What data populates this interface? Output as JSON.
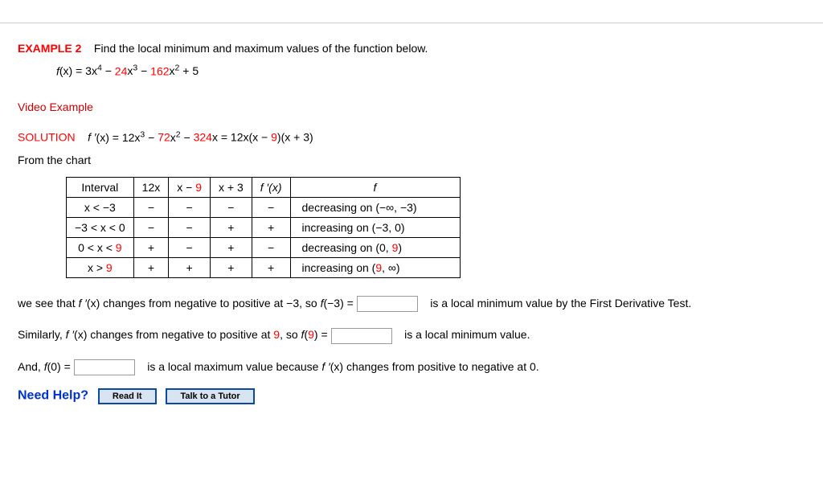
{
  "header": {
    "example_label": "EXAMPLE 2",
    "prompt_text": "Find the local minimum and maximum values of the function below.",
    "fx_lead": "f",
    "fx_open": "(x) = 3x",
    "fx_p1_sup": "4",
    "fx_p1_after": " − ",
    "fx_c2": "24",
    "fx_p2_x": "x",
    "fx_p2_sup": "3",
    "fx_p2_after": " − ",
    "fx_c3": "162",
    "fx_p3_x": "x",
    "fx_p3_sup": "2",
    "fx_tail": " + 5"
  },
  "video_link": "Video Example",
  "solution": {
    "label": "SOLUTION",
    "deriv_lead": "f ′",
    "deriv_open": "(x) = 12x",
    "deriv_sup1": "3",
    "deriv_mid1": " − ",
    "deriv_c2": "72",
    "deriv_x2": "x",
    "deriv_sup2": "2",
    "deriv_mid2": " − ",
    "deriv_c3": "324",
    "deriv_x3": "x",
    "deriv_factored_a": " = 12x(x − ",
    "deriv_root1": "9",
    "deriv_factored_b": ")(x + 3)",
    "from_chart": "From the chart"
  },
  "table": {
    "h1": "Interval",
    "h2": "12x",
    "h3a": "x − ",
    "h3b": "9",
    "h4": "x + 3",
    "h5": "f ′(x)",
    "h6": "f",
    "r1_int": "x < −3",
    "r1_a": "−",
    "r1_b": "−",
    "r1_c": "−",
    "r1_d": "−",
    "r1_desc": "decreasing on  (−∞, −3)",
    "r2_int": "−3 < x < 0",
    "r2_a": "−",
    "r2_b": "−",
    "r2_c": "+",
    "r2_d": "+",
    "r2_desc": "increasing on  (−3, 0)",
    "r3_int_a": "0 < x < ",
    "r3_int_b": "9",
    "r3_a": "+",
    "r3_b": "−",
    "r3_c": "+",
    "r3_d": "−",
    "r3_desc_a": "decreasing on  (0, ",
    "r3_desc_b": "9",
    "r3_desc_c": ")",
    "r4_int_a": "x > ",
    "r4_int_b": "9",
    "r4_a": "+",
    "r4_b": "+",
    "r4_c": "+",
    "r4_d": "+",
    "r4_desc_a": "increasing on  (",
    "r4_desc_b": "9",
    "r4_desc_c": ", ∞)"
  },
  "para1": {
    "t1": "we see that  ",
    "fprime": "f ′",
    "t2": "(x)  changes from negative to positive at  −3,  so  ",
    "f": "f",
    "t3": "(−3) = ",
    "t4": " is a local minimum value by the First Derivative Test."
  },
  "para2": {
    "t1": "Similarly,  ",
    "fprime": "f ′",
    "t2": "(x)  changes from negative to positive at ",
    "nine": "9",
    "t3": ", so  ",
    "f": "f",
    "t4": "(",
    "nine2": "9",
    "t5": ") = ",
    "t6": " is a local minimum value."
  },
  "para3": {
    "t1": "And,  ",
    "f": "f",
    "t2": "(0) = ",
    "t3": " is a local maximum value because  ",
    "fprime": "f ′",
    "t4": "(x)  changes from positive to negative at 0."
  },
  "help": {
    "label": "Need Help?",
    "read": "Read It",
    "tutor": "Talk to a Tutor"
  }
}
